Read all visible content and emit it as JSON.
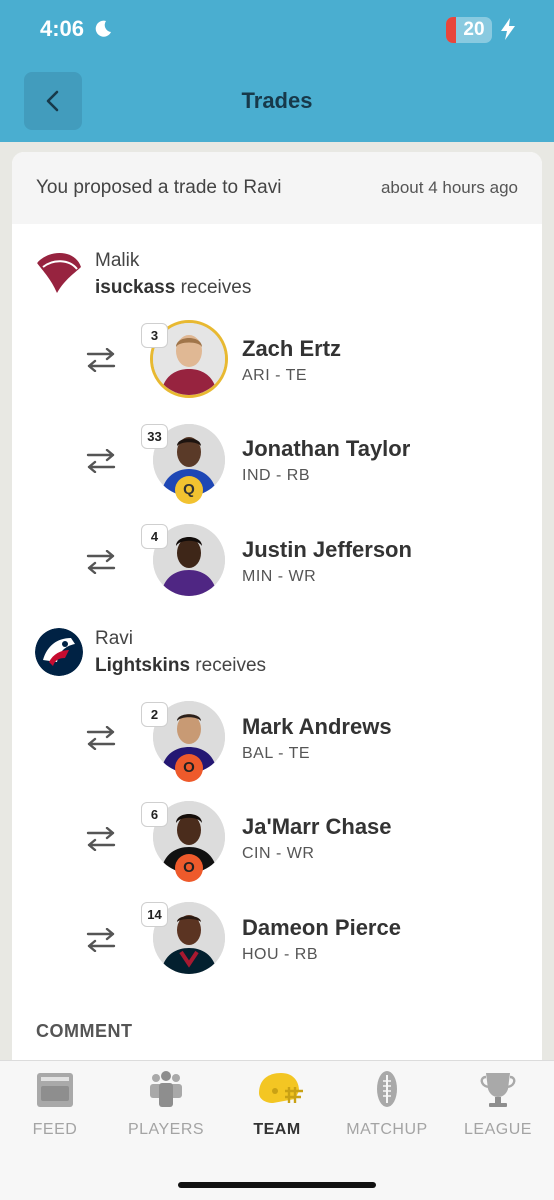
{
  "status_bar": {
    "time": "4:06",
    "battery": "20"
  },
  "header": {
    "title": "Trades"
  },
  "trade": {
    "proposal_text": "You proposed a trade to Ravi",
    "proposal_time": "about 4 hours ago",
    "sections": [
      {
        "owner": "Malik",
        "team_name": "isuckass",
        "receives_label": "receives",
        "players": [
          {
            "rank": "3",
            "name": "Zach Ertz",
            "pos": "ARI - TE",
            "status": ""
          },
          {
            "rank": "33",
            "name": "Jonathan Taylor",
            "pos": "IND - RB",
            "status": "Q"
          },
          {
            "rank": "4",
            "name": "Justin Jefferson",
            "pos": "MIN - WR",
            "status": ""
          }
        ]
      },
      {
        "owner": "Ravi",
        "team_name": "Lightskins",
        "receives_label": "receives",
        "players": [
          {
            "rank": "2",
            "name": "Mark Andrews",
            "pos": "BAL - TE",
            "status": "O"
          },
          {
            "rank": "6",
            "name": "Ja'Marr Chase",
            "pos": "CIN - WR",
            "status": "O"
          },
          {
            "rank": "14",
            "name": "Dameon Pierce",
            "pos": "HOU - RB",
            "status": ""
          }
        ]
      }
    ],
    "comment_label": "COMMENT"
  },
  "tabs": [
    {
      "label": "FEED",
      "icon": "feed-icon"
    },
    {
      "label": "PLAYERS",
      "icon": "players-icon"
    },
    {
      "label": "TEAM",
      "icon": "helmet-icon",
      "active": true
    },
    {
      "label": "MATCHUP",
      "icon": "football-icon"
    },
    {
      "label": "LEAGUE",
      "icon": "trophy-icon"
    }
  ],
  "colors": {
    "header": "#4aaed0",
    "active_tab_icon": "#f3c623",
    "questionable": "#f2c230",
    "out": "#ee5a2b"
  }
}
